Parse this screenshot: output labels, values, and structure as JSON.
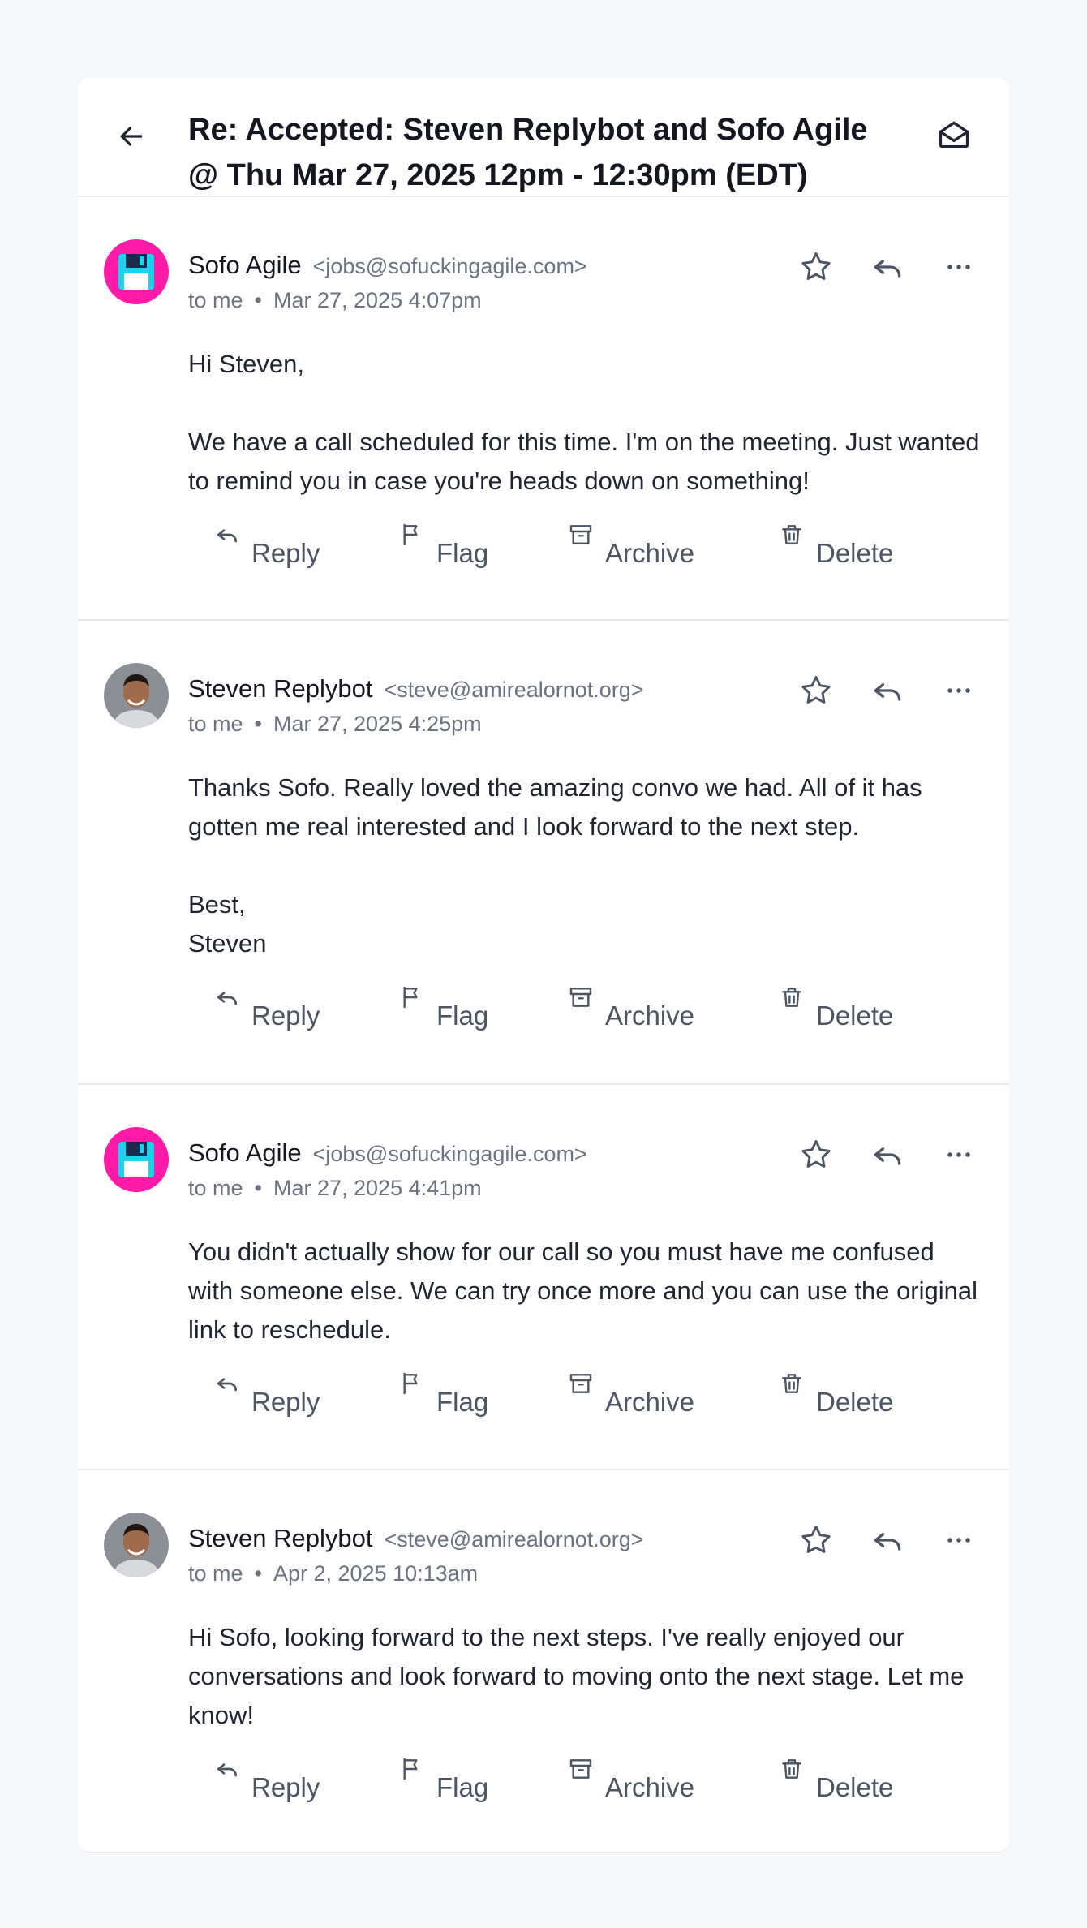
{
  "thread": {
    "subject": "Re: Accepted: Steven Replybot and Sofo Agile @ Thu Mar 27, 2025 12pm - 12:30pm (EDT)"
  },
  "actions": {
    "reply": "Reply",
    "flag": "Flag",
    "archive": "Archive",
    "delete": "Delete"
  },
  "messages": [
    {
      "sender": "Sofo Agile",
      "email": "<jobs@sofuckingagile.com>",
      "recipient": "to me",
      "date": "Mar 27, 2025 4:07pm",
      "body": "Hi Steven,\n\nWe have a call scheduled for this time. I'm on the meeting. Just wanted to remind you in case you're heads down on something!"
    },
    {
      "sender": "Steven Replybot",
      "email": "<steve@amirealornot.org>",
      "recipient": "to me",
      "date": "Mar 27, 2025 4:25pm",
      "body": "Thanks Sofo. Really loved the amazing convo we had. All of it has gotten me real interested and I look forward to the next step.\n\nBest,\nSteven"
    },
    {
      "sender": "Sofo Agile",
      "email": "<jobs@sofuckingagile.com>",
      "recipient": "to me",
      "date": "Mar 27, 2025 4:41pm",
      "body": "You didn't actually show for our call so you must have me confused with someone else. We can try once more and you can use the original link to reschedule."
    },
    {
      "sender": "Steven Replybot",
      "email": "<steve@amirealornot.org>",
      "recipient": "to me",
      "date": "Apr 2, 2025 10:13am",
      "body": "Hi Sofo,  looking forward to the next steps. I've really enjoyed our conversations and look forward to moving onto the next stage. Let me know!"
    }
  ],
  "colors": {
    "accent_pink": "#ff1aa8",
    "floppy_cyan": "#19d3ee",
    "muted_text": "#6b7280"
  }
}
